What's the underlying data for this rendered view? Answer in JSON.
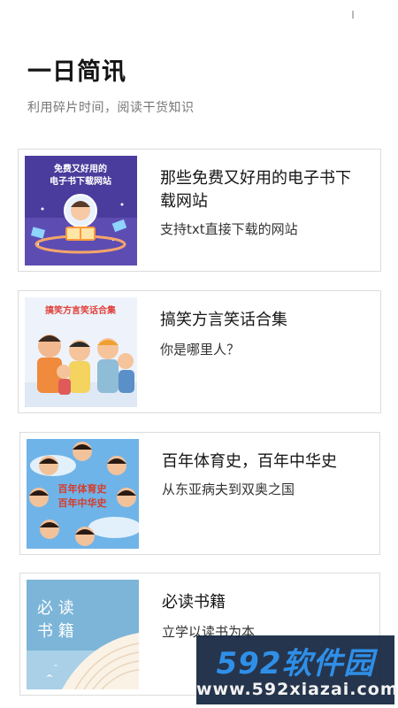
{
  "header": {
    "title": "一日简讯",
    "subtitle": "利用碎片时间，阅读干货知识"
  },
  "articles": [
    {
      "title": "那些免费又好用的电子书下载网站",
      "description": "支持txt直接下载的网站",
      "cover_text": [
        "免费又好用的",
        "电子书下载网站"
      ]
    },
    {
      "title": "搞笑方言笑话合集",
      "description": "你是哪里人？",
      "cover_text": [
        "搞笑方言笑话合集"
      ]
    },
    {
      "title": "百年体育史，百年中华史",
      "description": "从东亚病夫到双奥之国",
      "cover_text": [
        "百年体育史",
        "百年中华史"
      ]
    },
    {
      "title": "必读书籍",
      "description": "立学以读书为本",
      "cover_text": [
        "必 读",
        "书 籍"
      ]
    }
  ],
  "watermark": {
    "brand": "592软件园",
    "url": "www.592xiazai.com"
  },
  "colors": {
    "card_border": "#dcdcdc",
    "watermark_bg": "#12243e",
    "watermark_brand": "#2f8fe8"
  }
}
